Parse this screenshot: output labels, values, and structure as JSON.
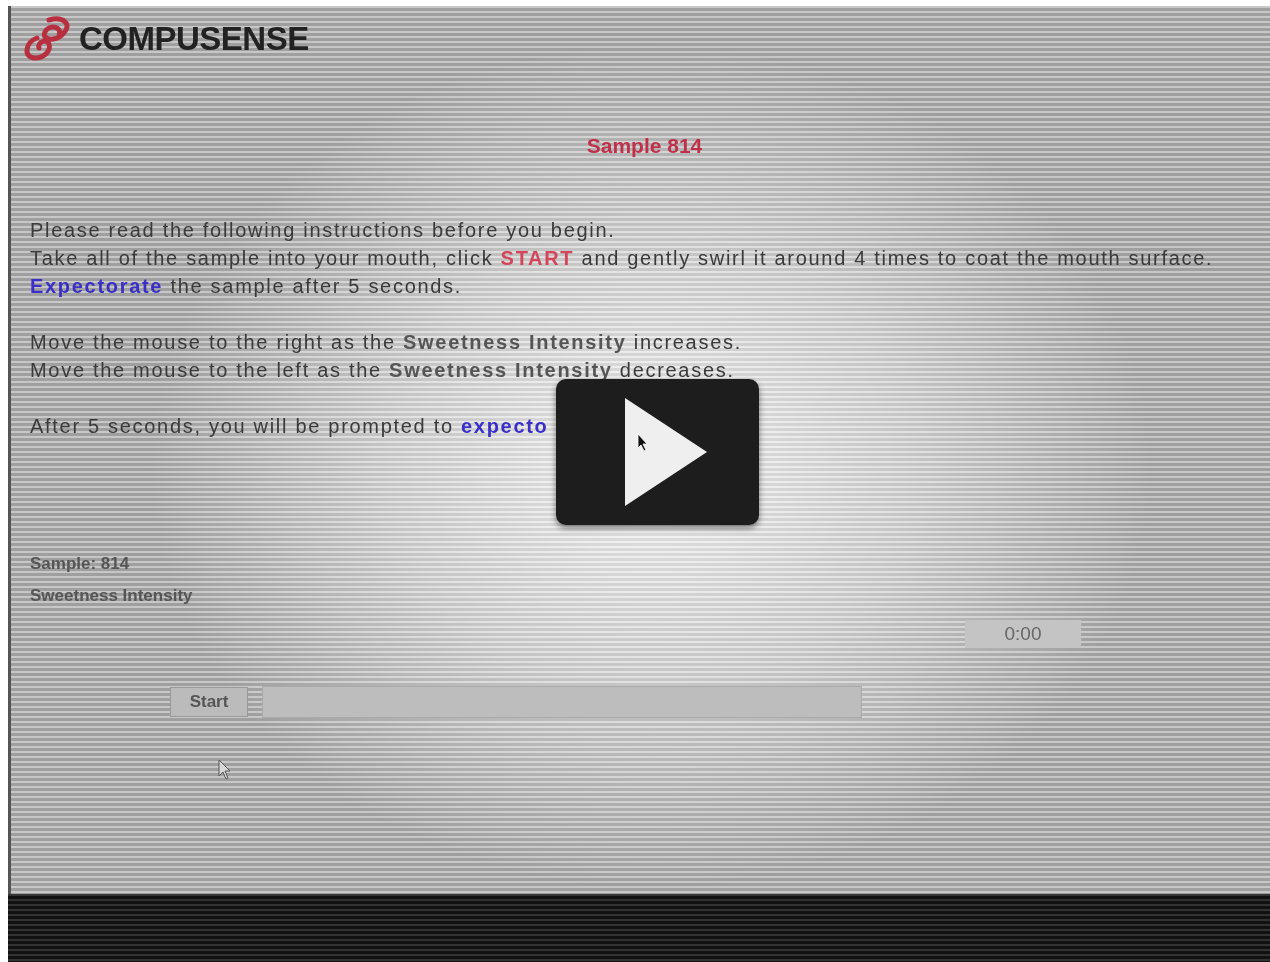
{
  "logo": {
    "text": "COMPUSENSE"
  },
  "title": "Sample 814",
  "instructions": [
    [
      [
        {
          "kind": "plain",
          "text": "Please read the following instructions before you begin."
        }
      ],
      [
        {
          "kind": "plain",
          "text": "Take all of the sample into your mouth, click "
        },
        {
          "kind": "alert",
          "text": "START"
        },
        {
          "kind": "plain",
          "text": " and gently swirl it around 4 times to coat the mouth surface."
        }
      ],
      [
        {
          "kind": "link",
          "text": "Expectorate"
        },
        {
          "kind": "plain",
          "text": " the sample after 5 seconds."
        }
      ]
    ],
    [
      [
        {
          "kind": "plain",
          "text": "Move the mouse to the right as the "
        },
        {
          "kind": "bold",
          "text": "Sweetness Intensity"
        },
        {
          "kind": "plain",
          "text": " increases."
        }
      ],
      [
        {
          "kind": "plain",
          "text": "Move the mouse to the left as the "
        },
        {
          "kind": "bold",
          "text": "Sweetness Intensity"
        },
        {
          "kind": "plain",
          "text": " decreases."
        }
      ]
    ],
    [
      [
        {
          "kind": "plain",
          "text": "After 5 seconds, you will be prompted to "
        },
        {
          "kind": "link",
          "text": "expecto"
        }
      ]
    ]
  ],
  "sample_label": "Sample: 814",
  "attribute_label": "Sweetness Intensity",
  "timer": "0:00",
  "start_button": "Start"
}
